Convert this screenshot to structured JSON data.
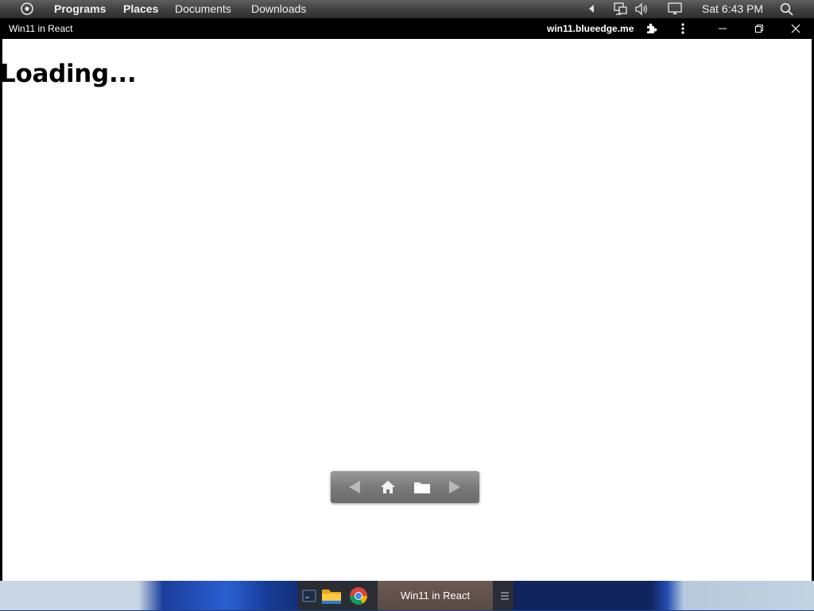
{
  "top_panel": {
    "menu": [
      "Programs",
      "Places",
      "Documents",
      "Downloads"
    ],
    "clock": "Sat  6:43 PM"
  },
  "window": {
    "title": "Win11 in React",
    "domain": "win11.blueedge.me"
  },
  "content": {
    "heading": "Loading..."
  },
  "taskbar": {
    "active_task": "Win11 in React"
  },
  "colors": {
    "panel": "#3f3f3f",
    "window_bg": "#000000",
    "content_bg": "#ffffff",
    "taskbar": "#2a2d36"
  },
  "icons": [
    "menu-circle-icon",
    "arrow-left-small-icon",
    "network-icon",
    "volume-icon",
    "display-icon",
    "search-icon",
    "puzzle-icon",
    "kebab-icon",
    "minimize-icon",
    "restore-icon",
    "close-icon",
    "back-arrow-icon",
    "home-icon",
    "folder-icon",
    "forward-arrow-icon",
    "terminal-icon",
    "file-explorer-icon",
    "chrome-icon",
    "taskbar-menu-icon"
  ]
}
